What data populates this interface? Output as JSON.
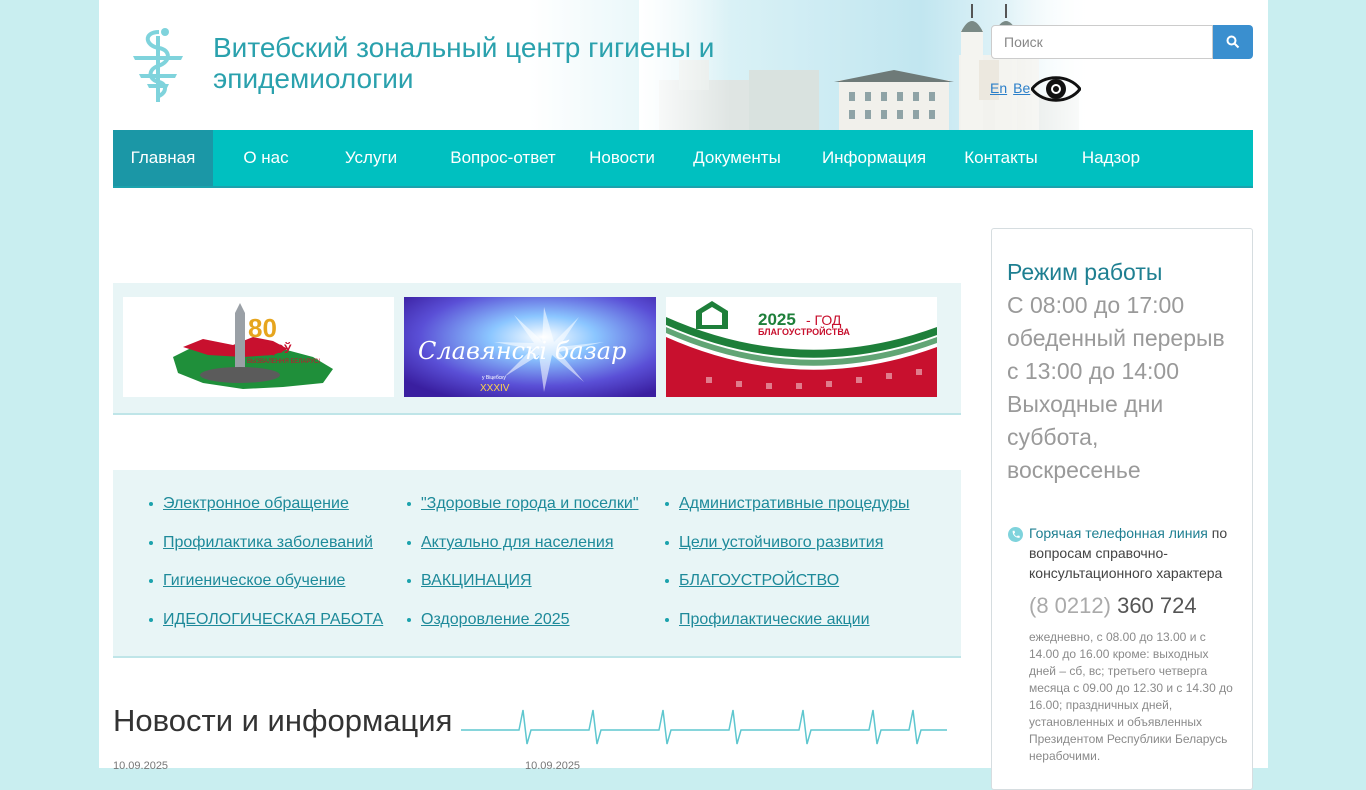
{
  "header": {
    "title_line1": "Витебский зональный центр гигиены и",
    "title_line2": "эпидемиологии",
    "search_placeholder": "Поиск",
    "lang_en": "En",
    "lang_be": "Be"
  },
  "nav": {
    "items": [
      {
        "label": "Главная"
      },
      {
        "label": "О нас"
      },
      {
        "label": "Услуги"
      },
      {
        "label": "Вопрос-ответ"
      },
      {
        "label": "Новости"
      },
      {
        "label": "Документы"
      },
      {
        "label": "Информация"
      },
      {
        "label": "Контакты"
      },
      {
        "label": "Надзор"
      }
    ]
  },
  "banners": [
    {
      "text_big": "80",
      "text_small": "ГАДОЎ",
      "text_sub": "ВЫЗВАЛЕННЯ БЕЛАРУСІ"
    },
    {
      "text_big": "Славянскі базар",
      "text_sub": "у Віцебску",
      "text_num": "XXXIV"
    },
    {
      "text_big": "2025",
      "text_mid": "- ГОД",
      "text_sub": "БЛАГОУСТРОЙСТВА"
    }
  ],
  "links": {
    "col1": [
      "Электронное обращение",
      "Профилактика заболеваний",
      "Гигиеническое обучение",
      "ИДЕОЛОГИЧЕСКАЯ РАБОТА"
    ],
    "col2": [
      "\"Здоровые города и поселки\"",
      "Актуально для населения",
      "ВАКЦИНАЦИЯ",
      "Оздоровление 2025"
    ],
    "col3": [
      "Административные процедуры",
      "Цели устойчивого развития",
      "БЛАГОУСТРОЙСТВО",
      "Профилактические акции"
    ]
  },
  "news": {
    "title": "Новости и информация",
    "date1": "10.09.2025",
    "date2": "10.09.2025"
  },
  "sidebar": {
    "title": "Режим работы",
    "lines": [
      "С 08:00 до 17:00",
      "обеденный перерыв",
      "с 13:00 до 14:00",
      "Выходные дни",
      "суббота,",
      "воскресенье"
    ],
    "hotline_label": "Горячая телефонная линия",
    "hotline_rest": " по вопросам справочно-консультационного характера",
    "phone_code": "(8 0212)",
    "phone_main": "360 724",
    "schedule": "ежедневно, с 08.00 до 13.00 и с 14.00 до 16.00 кроме: выходных дней – сб, вс; третьего четверга месяца с 09.00 до 12.30 и с 14.30 до 16.00; праздничных дней, установленных и объявленных Президентом Республики Беларусь нерабочими."
  },
  "colors": {
    "accent": "#00c0c0",
    "nav_active": "#1b97a6",
    "title": "#2aa1ad",
    "link": "#1e8a9a"
  }
}
